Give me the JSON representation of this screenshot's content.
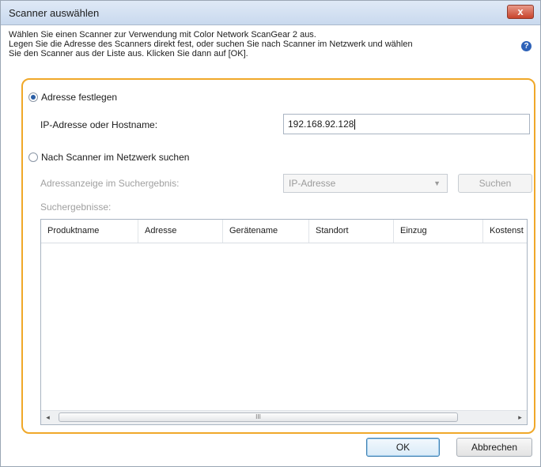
{
  "window": {
    "title": "Scanner auswählen",
    "close_glyph": "x"
  },
  "description": {
    "line1": "Wählen Sie einen Scanner zur Verwendung mit Color Network ScanGear 2 aus.",
    "line2": "Legen Sie die Adresse des Scanners direkt fest, oder suchen Sie nach Scanner im Netzwerk und wählen",
    "line3": "Sie den Scanner aus der Liste aus. Klicken Sie dann auf [OK]."
  },
  "help_icon": {
    "name": "help-icon",
    "glyph": "?"
  },
  "address_option": {
    "label": "Adresse festlegen",
    "checked": true,
    "field_label": "IP-Adresse oder Hostname:",
    "field_value": "192.168.92.128"
  },
  "search_option": {
    "label": "Nach Scanner im Netzwerk suchen",
    "checked": false,
    "display_label": "Adressanzeige im Suchergebnis:",
    "display_value": "IP-Adresse",
    "search_button": "Suchen",
    "results_label": "Suchergebnisse:"
  },
  "results_table": {
    "columns": [
      "Produktname",
      "Adresse",
      "Gerätename",
      "Standort",
      "Einzug",
      "Kostenst"
    ],
    "rows": []
  },
  "scrollbar": {
    "left_arrow": "◂",
    "right_arrow": "▸",
    "grip": "III"
  },
  "footer": {
    "ok_label": "OK",
    "cancel_label": "Abbrechen"
  },
  "colors": {
    "accent_frame": "#f0a829",
    "close_button": "#c8432b",
    "default_button_border": "#3c7fb1"
  }
}
